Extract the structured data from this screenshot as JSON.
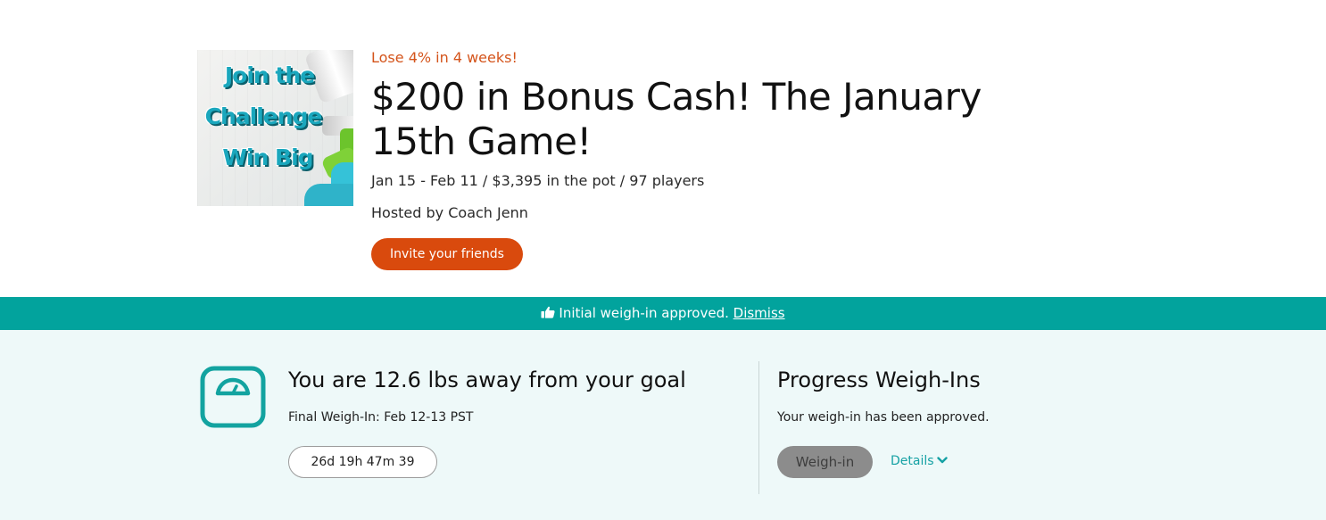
{
  "game": {
    "promo_image": {
      "lines": [
        "Join the",
        "Challenge",
        "Win Big"
      ]
    },
    "subtitle": "Lose 4% in 4 weeks!",
    "title": "$200 in Bonus Cash! The January 15th Game!",
    "meta": "Jan 15 - Feb 11  / $3,395 in the pot / 97 players",
    "host": "Hosted by Coach Jenn",
    "invite_label": "Invite your friends"
  },
  "notice": {
    "icon": "thumbs-up-icon",
    "message": "Initial weigh-in approved.",
    "dismiss_label": "Dismiss"
  },
  "goal": {
    "icon": "scale-icon",
    "heading": "You are 12.6 lbs away from your goal",
    "final_weigh_in": "Final Weigh-In: Feb 12-13 PST",
    "countdown": "26d 19h 47m 39"
  },
  "progress": {
    "heading": "Progress Weigh-Ins",
    "status": "Your weigh-in has been approved.",
    "weighin_label": "Weigh-in",
    "details_label": "Details"
  },
  "colors": {
    "accent_orange": "#d94a0d",
    "teal_bar": "#02a39d",
    "teal_icon": "#13a3a0",
    "panel_bg": "#eef9f9"
  }
}
